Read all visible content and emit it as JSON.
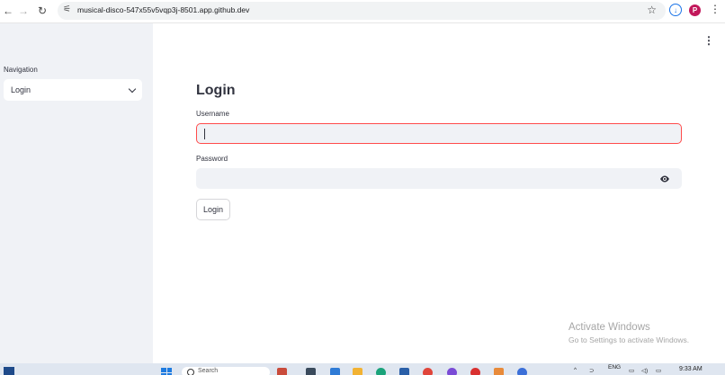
{
  "browser": {
    "url": "musical-disco-547x55v5vqp3j-8501.app.github.dev",
    "profile_initial": "P",
    "icons": [
      "back-icon",
      "forward-icon",
      "reload-icon",
      "site-info-icon",
      "star-icon",
      "extension-icon",
      "menu-dots-icon"
    ]
  },
  "sidebar": {
    "nav_label": "Navigation",
    "nav_select_value": "Login"
  },
  "main": {
    "title": "Login",
    "username_label": "Username",
    "username_value": "",
    "password_label": "Password",
    "password_value": "",
    "login_button": "Login"
  },
  "watermark": {
    "title": "Activate Windows",
    "subtitle": "Go to Settings to activate Windows."
  },
  "taskbar": {
    "search_placeholder": "Search",
    "language": "ENG",
    "time": "9:33 AM"
  },
  "colors": {
    "accent": "#ff4b4b",
    "sidebar_bg": "#f0f2f6",
    "input_bg": "#f0f2f6",
    "text": "#31333f"
  }
}
